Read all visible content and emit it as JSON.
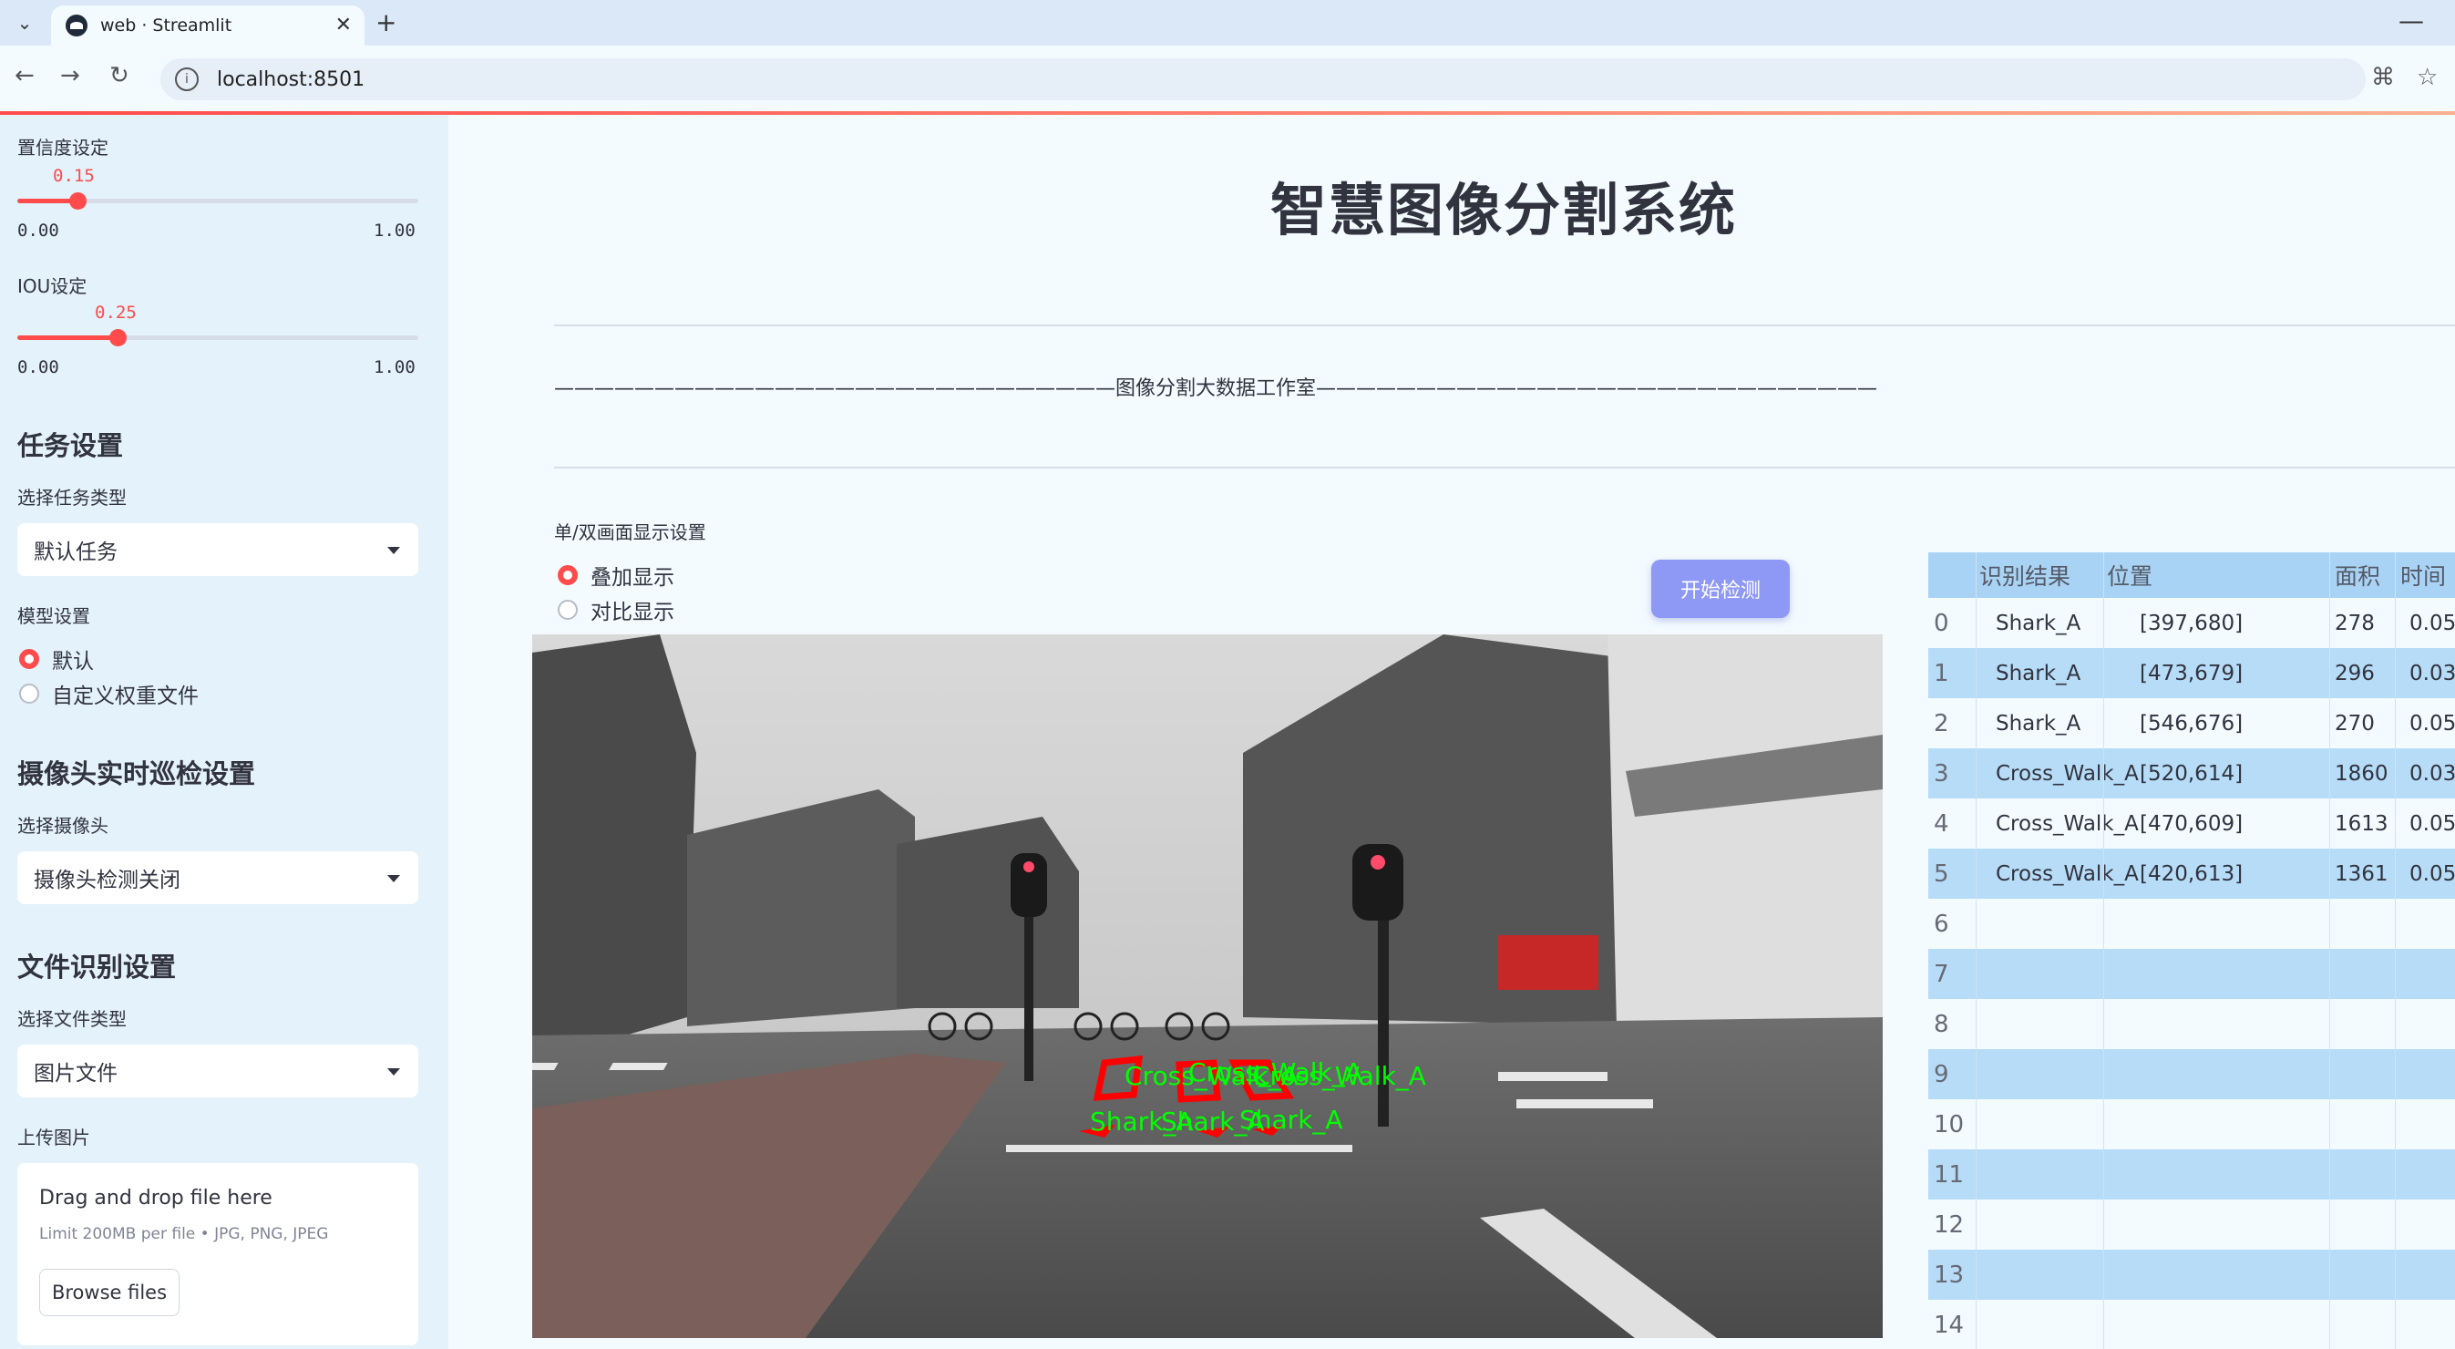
{
  "browser": {
    "tab_title": "web · Streamlit",
    "url": "localhost:8501"
  },
  "sidebar": {
    "confidence": {
      "label": "置信度设定",
      "value": "0.15",
      "min": "0.00",
      "max": "1.00",
      "fraction": 0.15
    },
    "iou": {
      "label": "IOU设定",
      "value": "0.25",
      "min": "0.00",
      "max": "1.00",
      "fraction": 0.25
    },
    "task": {
      "heading": "任务设置",
      "label": "选择任务类型",
      "selected": "默认任务"
    },
    "model": {
      "label": "模型设置",
      "options": [
        "默认",
        "自定义权重文件"
      ],
      "selected_index": 0
    },
    "camera": {
      "heading": "摄像头实时巡检设置",
      "label": "选择摄像头",
      "selected": "摄像头检测关闭"
    },
    "file": {
      "heading": "文件识别设置",
      "label": "选择文件类型",
      "selected": "图片文件"
    },
    "upload": {
      "label": "上传图片",
      "title": "Drag and drop file here",
      "subtitle": "Limit 200MB per file • JPG, PNG, JPEG",
      "button": "Browse files"
    }
  },
  "main": {
    "title": "智慧图像分割系统",
    "studio": "————————————————————————————图像分割大数据工作室————————————————————————————",
    "display_label": "单/双画面显示设置",
    "display_options": [
      "叠加显示",
      "对比显示"
    ],
    "display_selected": 0,
    "start_button": "开始检测",
    "overlay_labels": [
      "Cross_Walk_A",
      "Cross_Walk_A",
      "Cross_Walk_A",
      "Shark_A",
      "Shark_A",
      "Shark_A"
    ]
  },
  "table": {
    "headers": [
      "识别结果",
      "位置",
      "面积",
      "时间"
    ],
    "rows": [
      {
        "idx": "0",
        "result": "Shark_A",
        "pos": "[397,680]",
        "area": "278",
        "time": "0.05"
      },
      {
        "idx": "1",
        "result": "Shark_A",
        "pos": "[473,679]",
        "area": "296",
        "time": "0.03"
      },
      {
        "idx": "2",
        "result": "Shark_A",
        "pos": "[546,676]",
        "area": "270",
        "time": "0.05"
      },
      {
        "idx": "3",
        "result": "Cross_Walk_A",
        "pos": "[520,614]",
        "area": "1860",
        "time": "0.03"
      },
      {
        "idx": "4",
        "result": "Cross_Walk_A",
        "pos": "[470,609]",
        "area": "1613",
        "time": "0.05"
      },
      {
        "idx": "5",
        "result": "Cross_Walk_A",
        "pos": "[420,613]",
        "area": "1361",
        "time": "0.05"
      },
      {
        "idx": "6",
        "result": "",
        "pos": "",
        "area": "",
        "time": ""
      },
      {
        "idx": "7",
        "result": "",
        "pos": "",
        "area": "",
        "time": ""
      },
      {
        "idx": "8",
        "result": "",
        "pos": "",
        "area": "",
        "time": ""
      },
      {
        "idx": "9",
        "result": "",
        "pos": "",
        "area": "",
        "time": ""
      },
      {
        "idx": "10",
        "result": "",
        "pos": "",
        "area": "",
        "time": ""
      },
      {
        "idx": "11",
        "result": "",
        "pos": "",
        "area": "",
        "time": ""
      },
      {
        "idx": "12",
        "result": "",
        "pos": "",
        "area": "",
        "time": ""
      },
      {
        "idx": "13",
        "result": "",
        "pos": "",
        "area": "",
        "time": ""
      },
      {
        "idx": "14",
        "result": "",
        "pos": "",
        "area": "",
        "time": ""
      }
    ]
  },
  "colors": {
    "accent": "#ff4b4b",
    "button": "#8e98f5",
    "overlay_text": "#00ff00",
    "overlay_box": "#ff0000"
  }
}
